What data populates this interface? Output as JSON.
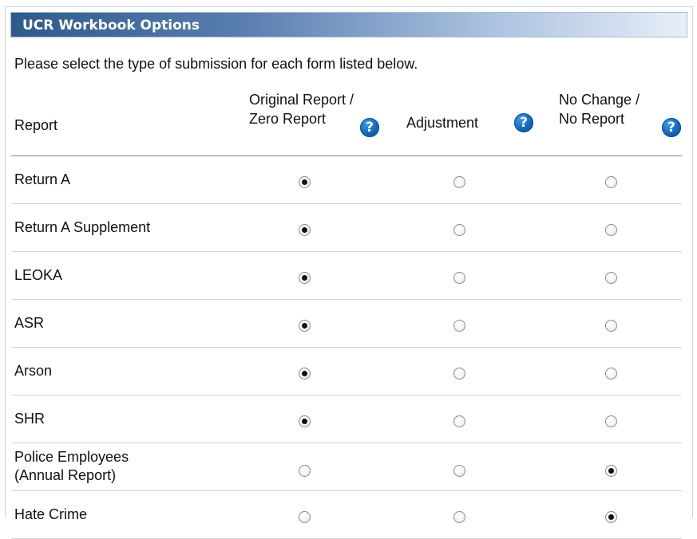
{
  "panel": {
    "title": "UCR Workbook Options",
    "intro": "Please select the type of submission for each form listed below."
  },
  "columns": {
    "report": "Report",
    "col1_line1": "Original Report /",
    "col1_line2": "Zero Report",
    "col2": "Adjustment",
    "col3_line1": "No Change /",
    "col3_line2": "No Report",
    "help_glyph": "?"
  },
  "rows": [
    {
      "label": "Return A",
      "selected": "original"
    },
    {
      "label": "Return A Supplement",
      "selected": "original"
    },
    {
      "label": "LEOKA",
      "selected": "original"
    },
    {
      "label": "ASR",
      "selected": "original"
    },
    {
      "label": "Arson",
      "selected": "original"
    },
    {
      "label": "SHR",
      "selected": "original"
    },
    {
      "label_line1": "Police Employees",
      "label_line2": "(Annual Report)",
      "selected": "no_change"
    },
    {
      "label": "Hate Crime",
      "selected": "no_change"
    }
  ],
  "colors": {
    "header_gradient_start": "#2f5a8c",
    "header_gradient_end": "#e7eef8",
    "help_icon": "#1466b8"
  }
}
